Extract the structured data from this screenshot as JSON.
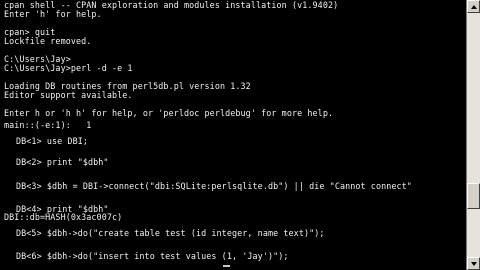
{
  "console": {
    "lines": [
      "cpan shell -- CPAN exploration and modules installation (v1.9402)",
      "Enter 'h' for help.",
      "",
      "cpan> quit",
      "Lockfile removed.",
      "",
      "C:\\Users\\Jay>",
      "C:\\Users\\Jay>perl -d -e 1",
      "",
      "Loading DB routines from perl5db.pl version 1.32",
      "Editor support available.",
      "",
      "Enter h or 'h h' for help, or 'perldoc perldebug' for more help.",
      "",
      "main::(-e:1):   1",
      "DB<1> use DBI;",
      "DB<2> print \"$dbh\"",
      "DB<3> $dbh = DBI->connect(\"dbi:SQLite:perlsqlite.db\") || die \"Cannot connect\"",
      "DB<4> print \"$dbh\"",
      "DBI::db=HASH(0x3ac007c)",
      "DB<5> $dbh->do(\"create table test (id integer, name text)\");",
      "DB<6> $dbh->do(\"insert into test values (1, 'Jay')\");"
    ]
  },
  "scrollbar": {
    "position": 0.78
  }
}
